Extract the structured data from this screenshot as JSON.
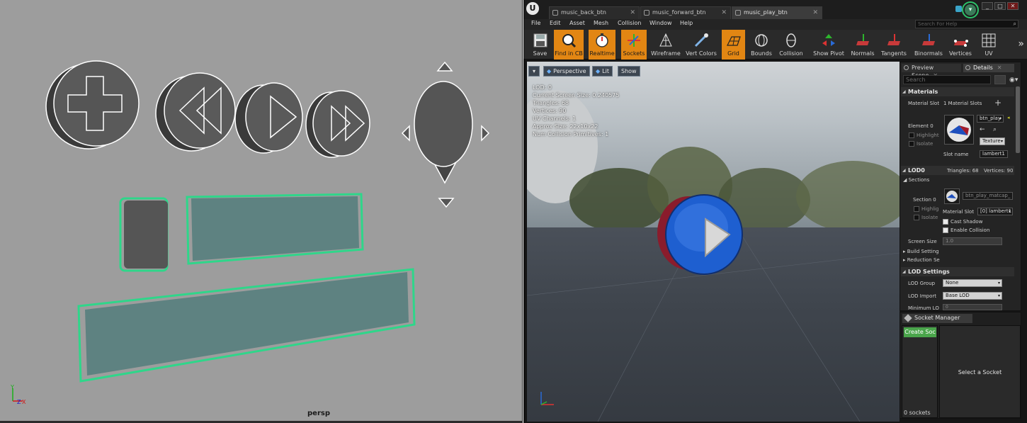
{
  "maya": {
    "camera_label": "persp",
    "axis_labels": {
      "x": "X",
      "y": "Y",
      "z": "Z"
    }
  },
  "ue": {
    "tabs": [
      {
        "label": "music_back_btn",
        "active": false
      },
      {
        "label": "music_forward_btn",
        "active": false
      },
      {
        "label": "music_play_btn",
        "active": true
      }
    ],
    "window_buttons": {
      "minimize": "_",
      "maximize": "□",
      "close": "✕"
    },
    "menu": [
      "File",
      "Edit",
      "Asset",
      "Mesh",
      "Collision",
      "Window",
      "Help"
    ],
    "search_help_placeholder": "Search For Help",
    "toolbar": [
      {
        "label": "Save",
        "icon": "save-icon",
        "active": false
      },
      {
        "label": "Find in CB",
        "icon": "find-in-cb-icon",
        "active": true
      },
      {
        "label": "Realtime",
        "icon": "realtime-icon",
        "active": true
      },
      {
        "label": "Sockets",
        "icon": "sockets-icon",
        "active": true
      },
      {
        "label": "Wireframe",
        "icon": "wireframe-icon",
        "active": false
      },
      {
        "label": "Vert Colors",
        "icon": "vert-colors-icon",
        "active": false
      },
      {
        "label": "Grid",
        "icon": "grid-icon",
        "active": true
      },
      {
        "label": "Bounds",
        "icon": "bounds-icon",
        "active": false
      },
      {
        "label": "Collision",
        "icon": "collision-icon",
        "active": false
      },
      {
        "label": "Show Pivot",
        "icon": "show-pivot-icon",
        "active": false
      },
      {
        "label": "Normals",
        "icon": "normals-icon",
        "active": false
      },
      {
        "label": "Tangents",
        "icon": "tangents-icon",
        "active": false
      },
      {
        "label": "Binormals",
        "icon": "binormals-icon",
        "active": false
      },
      {
        "label": "Vertices",
        "icon": "vertices-icon",
        "active": false
      },
      {
        "label": "UV",
        "icon": "uv-icon",
        "active": false
      }
    ],
    "viewport": {
      "buttons": {
        "perspective": "Perspective",
        "lit": "Lit",
        "show": "Show"
      },
      "stats": [
        "LOD:  0",
        "Current Screen Size:  0.240575",
        "Triangles:  68",
        "Vertices:  90",
        "UV Channels:  1",
        "Approx Size: 22x10x22",
        "Num Collision Primitives:  1"
      ]
    },
    "details": {
      "tabs": {
        "preview": "Preview Scene",
        "details": "Details"
      },
      "search_placeholder": "Search",
      "materials": {
        "header": "Materials",
        "slot_label": "Material Slot",
        "slot_count": "1 Material Slots",
        "element_label": "Element 0",
        "highlight": "Highlight",
        "isolate": "Isolate",
        "material_name": "btn_play",
        "textures_label": "Texture",
        "slot_name_label": "Slot name",
        "slot_name_value": "lambert1"
      },
      "lod0": {
        "header": "LOD0",
        "triangles": "Triangles: 68",
        "vertices": "Vertices: 90",
        "sections": "Sections",
        "section0": "Section 0",
        "highlight": "Highlig",
        "isolate": "Isolate",
        "material_name": "btn_play_matcap_",
        "material_slot_label": "Material Slot",
        "material_slot_value": "[0] lambert1",
        "cast_shadow": "Cast Shadow",
        "enable_collision": "Enable Collision",
        "screen_size_label": "Screen Size",
        "screen_size_value": "1.0",
        "build_settings": "Build Setting",
        "reduction_settings": "Reduction Se"
      },
      "lod_settings": {
        "header": "LOD Settings",
        "lod_group_label": "LOD Group",
        "lod_group_value": "None",
        "lod_import_label": "LOD Import",
        "lod_import_value": "Base LOD",
        "minimum_lod_label": "Minimum LO",
        "minimum_lod_value": "0"
      }
    },
    "socket_manager": {
      "title": "Socket Manager",
      "create_button": "Create Soc",
      "select_hint": "Select a Socket",
      "count": "0 sockets"
    },
    "colors": {
      "accent_orange": "#e28613",
      "green": "#4aa54b",
      "blue_button": "#1e5fd0"
    }
  }
}
